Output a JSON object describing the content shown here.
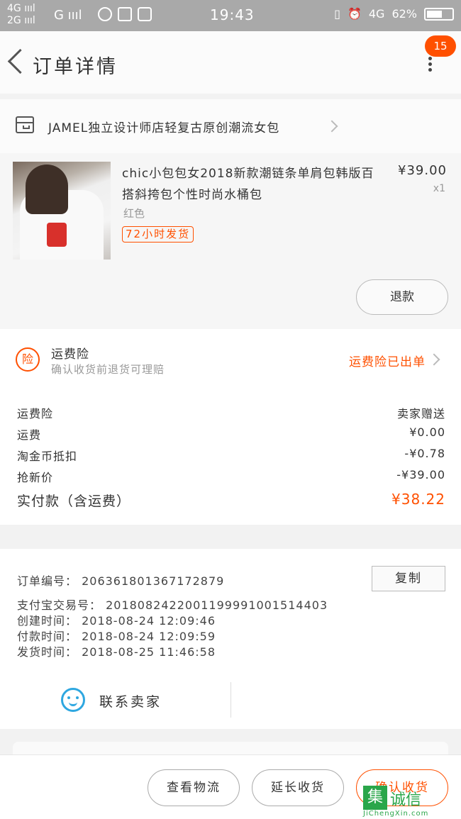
{
  "status_bar": {
    "signal_1": "4G",
    "signal_2": "2G",
    "carrier": "G",
    "time": "19:43",
    "network": "4G",
    "battery_text": "62%",
    "battery_level": 0.62
  },
  "header": {
    "title": "订单详情",
    "badge": "15"
  },
  "shop": {
    "name": "JAMEL独立设计师店轻复古原创潮流女包"
  },
  "product": {
    "title": "chic小包包女2018新款潮链条单肩包韩版百搭斜挎包个性时尚水桶包",
    "sku": "红色",
    "tag": "72小时发货",
    "price": "¥39.00",
    "quantity": "x1",
    "refund_label": "退款"
  },
  "insurance": {
    "icon_char": "险",
    "title": "运费险",
    "subtitle": "确认收货前退货可理赔",
    "status": "运费险已出单"
  },
  "fees": [
    {
      "label": "运费险",
      "value": "卖家赠送"
    },
    {
      "label": "运费",
      "value": "¥0.00"
    },
    {
      "label": "淘金币抵扣",
      "value": "-¥0.78"
    },
    {
      "label": "抢新价",
      "value": "-¥39.00"
    }
  ],
  "total": {
    "label": "实付款（含运费）",
    "value": "¥38.22"
  },
  "order_info": {
    "order_no": "订单编号： 206361801367172879",
    "alipay_no": "支付宝交易号： 2018082422001199991001514403",
    "created": "创建时间： 2018-08-24 12:09:46",
    "paid": "付款时间： 2018-08-24 12:09:59",
    "shipped": "发货时间： 2018-08-25 11:46:58",
    "copy_label": "复制"
  },
  "contact": {
    "label": "联系卖家"
  },
  "actions": {
    "logistics": "查看物流",
    "extend": "延长收货",
    "confirm": "确认收货"
  },
  "watermark": {
    "box": "集",
    "text": "诚信",
    "url": "JiChengXin.com"
  },
  "colors": {
    "accent": "#ff5000",
    "contact_blue": "#2ea7e0",
    "watermark_green": "#2aa64a"
  }
}
